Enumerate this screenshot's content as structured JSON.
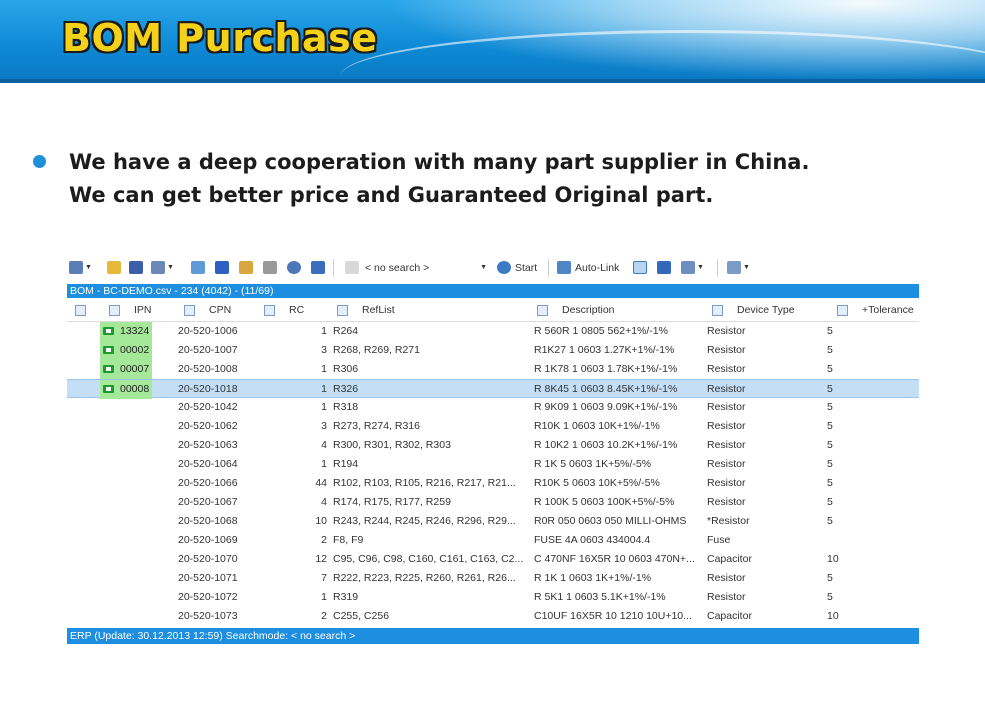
{
  "slide": {
    "title": "BOM Purchase",
    "bullet_lines": [
      "We have a deep cooperation with many part supplier in China.",
      "We can get better price and Guaranteed Original part."
    ]
  },
  "app": {
    "toolbar": {
      "search_placeholder": "< no search >",
      "start_label": "Start",
      "autolink_label": "Auto-Link"
    },
    "window_title": "BOM - BC-DEMO.csv - 234 (4042) - (11/69)",
    "columns": {
      "ipn": "IPN",
      "cpn": "CPN",
      "rc": "RC",
      "reflist": "RefList",
      "description": "Description",
      "device_type": "Device Type",
      "tolerance": "+Tolerance"
    },
    "rows": [
      {
        "ipn": "13324",
        "cpn": "20-520-1006",
        "rc": "1",
        "reflist": "R264",
        "description": "R 560R 1 0805 562+1%/-1%",
        "device_type": "Resistor",
        "tolerance": "5"
      },
      {
        "ipn": "00002",
        "cpn": "20-520-1007",
        "rc": "3",
        "reflist": "R268, R269, R271",
        "description": "R1K27 1 0603 1.27K+1%/-1%",
        "device_type": "Resistor",
        "tolerance": "5"
      },
      {
        "ipn": "00007",
        "cpn": "20-520-1008",
        "rc": "1",
        "reflist": "R306",
        "description": "R 1K78 1 0603 1.78K+1%/-1%",
        "device_type": "Resistor",
        "tolerance": "5"
      },
      {
        "ipn": "00008",
        "cpn": "20-520-1018",
        "rc": "1",
        "reflist": "R326",
        "description": "R 8K45 1 0603 8.45K+1%/-1%",
        "device_type": "Resistor",
        "tolerance": "5"
      },
      {
        "ipn": "",
        "cpn": "20-520-1042",
        "rc": "1",
        "reflist": "R318",
        "description": "R 9K09 1 0603 9.09K+1%/-1%",
        "device_type": "Resistor",
        "tolerance": "5"
      },
      {
        "ipn": "",
        "cpn": "20-520-1062",
        "rc": "3",
        "reflist": "R273, R274, R316",
        "description": "R10K 1 0603 10K+1%/-1%",
        "device_type": "Resistor",
        "tolerance": "5"
      },
      {
        "ipn": "",
        "cpn": "20-520-1063",
        "rc": "4",
        "reflist": "R300, R301, R302, R303",
        "description": "R 10K2 1 0603 10.2K+1%/-1%",
        "device_type": "Resistor",
        "tolerance": "5"
      },
      {
        "ipn": "",
        "cpn": "20-520-1064",
        "rc": "1",
        "reflist": "R194",
        "description": "R 1K 5 0603 1K+5%/-5%",
        "device_type": "Resistor",
        "tolerance": "5"
      },
      {
        "ipn": "",
        "cpn": "20-520-1066",
        "rc": "44",
        "reflist": "R102, R103, R105, R216, R217, R21...",
        "description": "R10K 5 0603 10K+5%/-5%",
        "device_type": "Resistor",
        "tolerance": "5"
      },
      {
        "ipn": "",
        "cpn": "20-520-1067",
        "rc": "4",
        "reflist": "R174, R175, R177, R259",
        "description": "R 100K 5 0603 100K+5%/-5%",
        "device_type": "Resistor",
        "tolerance": "5"
      },
      {
        "ipn": "",
        "cpn": "20-520-1068",
        "rc": "10",
        "reflist": "R243, R244, R245, R246, R296, R29...",
        "description": "R0R 050 0603 050 MILLI-OHMS",
        "device_type": "*Resistor",
        "tolerance": "5"
      },
      {
        "ipn": "",
        "cpn": "20-520-1069",
        "rc": "2",
        "reflist": "F8, F9",
        "description": "FUSE 4A 0603 434004.4",
        "device_type": "Fuse",
        "tolerance": ""
      },
      {
        "ipn": "",
        "cpn": "20-520-1070",
        "rc": "12",
        "reflist": "C95, C96, C98, C160, C161, C163, C2...",
        "description": "C 470NF 16X5R 10 0603 470N+...",
        "device_type": "Capacitor",
        "tolerance": "10"
      },
      {
        "ipn": "",
        "cpn": "20-520-1071",
        "rc": "7",
        "reflist": "R222, R223, R225, R260, R261, R26...",
        "description": "R 1K 1 0603 1K+1%/-1%",
        "device_type": "Resistor",
        "tolerance": "5"
      },
      {
        "ipn": "",
        "cpn": "20-520-1072",
        "rc": "1",
        "reflist": "R319",
        "description": "R 5K1 1 0603 5.1K+1%/-1%",
        "device_type": "Resistor",
        "tolerance": "5"
      },
      {
        "ipn": "",
        "cpn": "20-520-1073",
        "rc": "2",
        "reflist": "C255, C256",
        "description": "C10UF 16X5R 10 1210 10U+10...",
        "device_type": "Capacitor",
        "tolerance": "10"
      }
    ],
    "status_bar": "ERP (Update: 30.12.2013 12:59)      Searchmode: < no search >"
  },
  "colors": {
    "banner_blue": "#1e96de",
    "title_yellow": "#f5d21a",
    "bullet_blue": "#1e8fd8",
    "app_bar_blue": "#1e8fe0",
    "selected_row": "#c3def5",
    "ipn_highlight": "#a6e89a"
  }
}
